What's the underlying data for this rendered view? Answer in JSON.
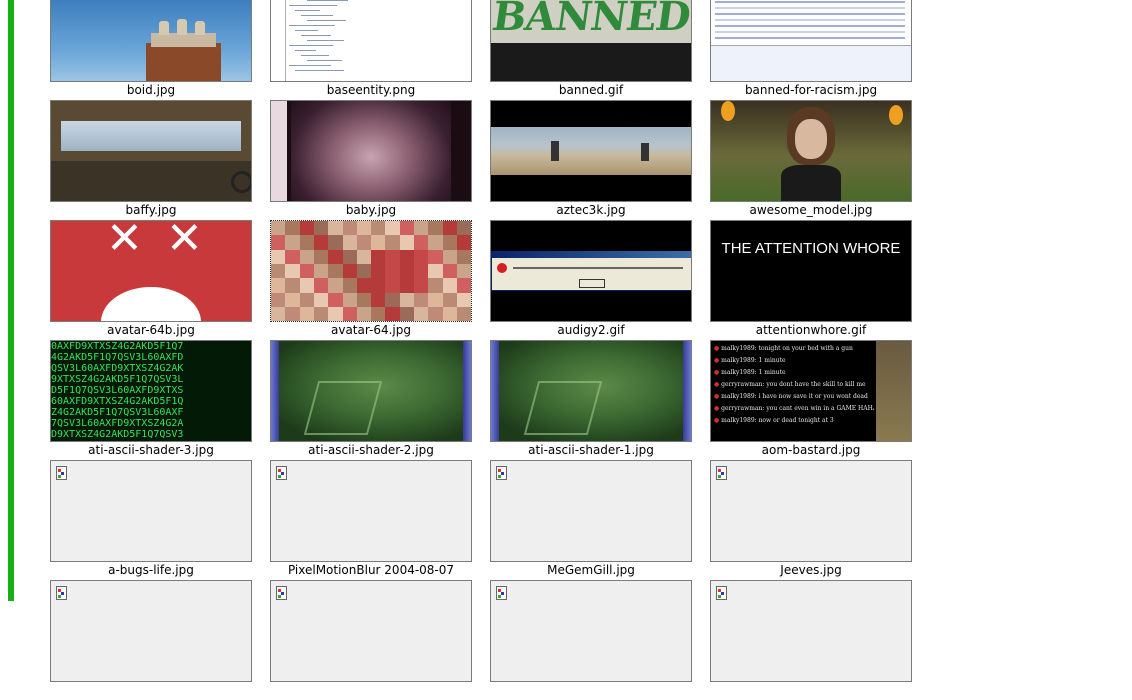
{
  "items": [
    {
      "name": "boid.jpg",
      "icon": "photo-sky-chimney-icon"
    },
    {
      "name": "baseentity.png",
      "icon": "class-tree-icon"
    },
    {
      "name": "banned.gif",
      "icon": "banned-graffiti-icon"
    },
    {
      "name": "banned-for-racism.jpg",
      "icon": "email-list-icon"
    },
    {
      "name": "baffy.jpg",
      "icon": "vehicle-view-icon"
    },
    {
      "name": "baby.jpg",
      "icon": "ultrasound-icon"
    },
    {
      "name": "aztec3k.jpg",
      "icon": "game-panorama-icon"
    },
    {
      "name": "awesome_model.jpg",
      "icon": "character-model-icon"
    },
    {
      "name": "avatar-64b.jpg",
      "icon": "face-x-eyes-icon"
    },
    {
      "name": "avatar-64.jpg",
      "icon": "pixelated-icon",
      "selected": true
    },
    {
      "name": "audigy2.gif",
      "icon": "error-dialog-icon"
    },
    {
      "name": "attentionwhore.gif",
      "icon": "text-banner-icon",
      "banner_text": "THE ATTENTION WHORE"
    },
    {
      "name": "ati-ascii-shader-3.jpg",
      "icon": "matrix-ascii-icon"
    },
    {
      "name": "ati-ascii-shader-2.jpg",
      "icon": "green-shader-icon"
    },
    {
      "name": "ati-ascii-shader-1.jpg",
      "icon": "green-shader-icon"
    },
    {
      "name": "aom-bastard.jpg",
      "icon": "chat-log-icon",
      "chat_lines": [
        "malky1989: tonight on your bed with a gun",
        "malky1989: 1 minute",
        "malky1989: 1 minute",
        "gerryrawman: you dont have the skill to kill me",
        "malky1989: i have now save it or you wont dead",
        "gerryrawman: you cant even win in a GAME HAHA",
        "malky1989: now or dead tonight at 3"
      ]
    },
    {
      "name": "a-bugs-life.jpg",
      "icon": "broken-image-icon"
    },
    {
      "name": "PixelMotionBlur 2004-08-07",
      "icon": "broken-image-icon"
    },
    {
      "name": "MeGemGill.jpg",
      "icon": "broken-image-icon"
    },
    {
      "name": "Jeeves.jpg",
      "icon": "broken-image-icon"
    },
    {
      "name": "",
      "icon": "broken-image-icon"
    },
    {
      "name": "",
      "icon": "broken-image-icon"
    },
    {
      "name": "",
      "icon": "broken-image-icon"
    },
    {
      "name": "",
      "icon": "broken-image-icon"
    }
  ]
}
